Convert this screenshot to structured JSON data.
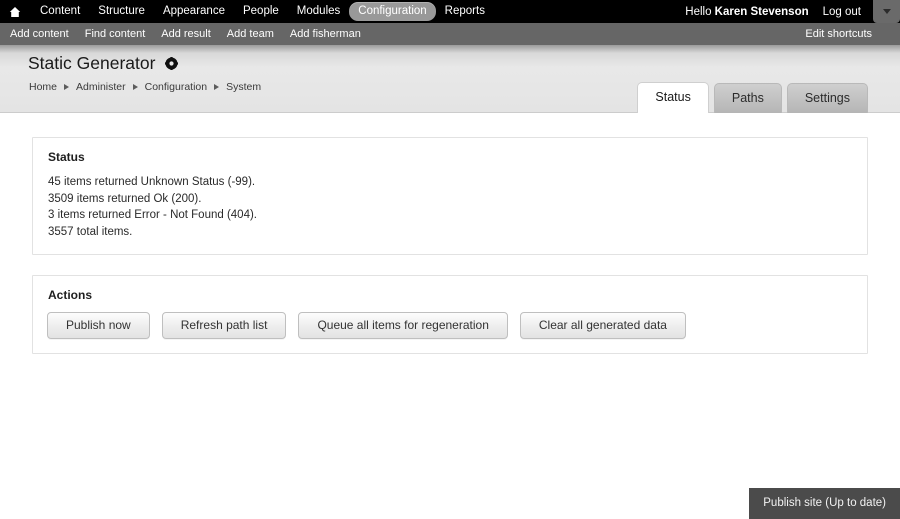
{
  "toolbar": {
    "home_icon": "home-icon",
    "items": [
      {
        "label": "Content",
        "active": false
      },
      {
        "label": "Structure",
        "active": false
      },
      {
        "label": "Appearance",
        "active": false
      },
      {
        "label": "People",
        "active": false
      },
      {
        "label": "Modules",
        "active": false
      },
      {
        "label": "Configuration",
        "active": true
      },
      {
        "label": "Reports",
        "active": false
      }
    ],
    "greeting_prefix": "Hello ",
    "user_name": "Karen Stevenson",
    "logout_label": "Log out",
    "dropdown_icon": "chevron-down-icon"
  },
  "shortcuts": {
    "items": [
      {
        "label": "Add content"
      },
      {
        "label": "Find content"
      },
      {
        "label": "Add result"
      },
      {
        "label": "Add team"
      },
      {
        "label": "Add fisherman"
      }
    ],
    "edit_label": "Edit shortcuts"
  },
  "header": {
    "title": "Static Generator",
    "title_icon": "gear-icon",
    "breadcrumb": [
      {
        "label": "Home"
      },
      {
        "label": "Administer"
      },
      {
        "label": "Configuration"
      },
      {
        "label": "System"
      }
    ]
  },
  "tabs": [
    {
      "label": "Status",
      "active": true
    },
    {
      "label": "Paths",
      "active": false
    },
    {
      "label": "Settings",
      "active": false
    }
  ],
  "status_panel": {
    "title": "Status",
    "lines": [
      "45 items returned Unknown Status (-99).",
      "3509 items returned Ok (200).",
      "3 items returned Error - Not Found (404).",
      "3557 total items."
    ]
  },
  "actions_panel": {
    "title": "Actions",
    "buttons": [
      {
        "label": "Publish now"
      },
      {
        "label": "Refresh path list"
      },
      {
        "label": "Queue all items for regeneration"
      },
      {
        "label": "Clear all generated data"
      }
    ]
  },
  "status_bar": {
    "label": "Publish site (Up to date)"
  },
  "colors": {
    "toolbar_bg": "#000000",
    "shortcut_bg": "#666666",
    "active_pill": "#999999",
    "statusbar_bg": "#4b4b4b",
    "panel_border": "#e2e2e2"
  }
}
